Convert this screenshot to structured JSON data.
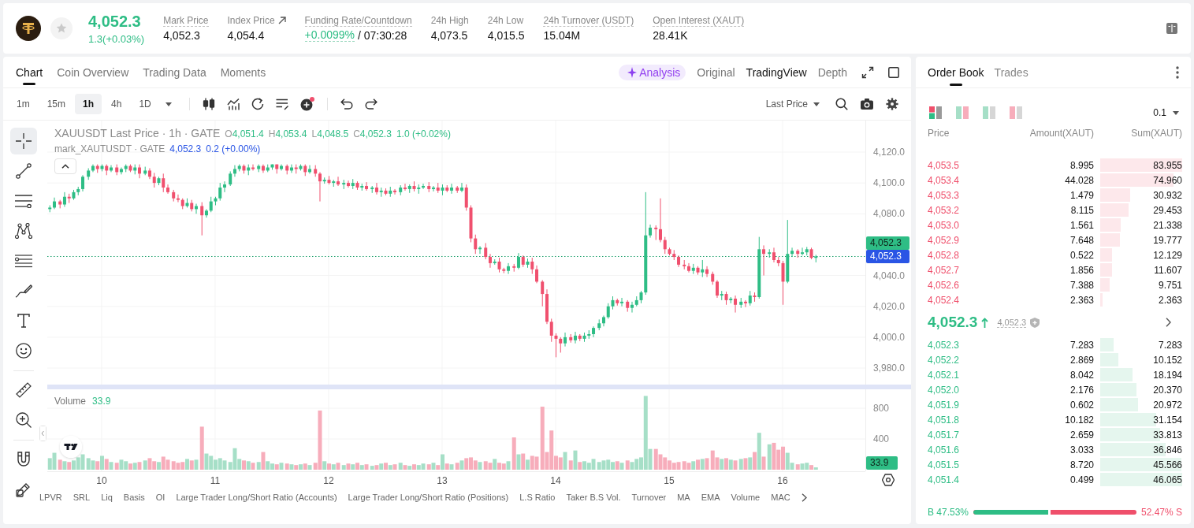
{
  "header": {
    "price": "4,052.3",
    "change": "1.3(+0.03%)",
    "stats": [
      {
        "kind": "plain",
        "label": "Mark Price",
        "value": "4,052.3",
        "underlined": true
      },
      {
        "kind": "link",
        "label": "Index Price",
        "value": "4,054.4",
        "underlined": false
      },
      {
        "kind": "funding",
        "label": "Funding Rate/Countdown",
        "rate": "+0.0099%",
        "value": "/ 07:30:28",
        "underlined": true
      },
      {
        "kind": "plain",
        "label": "24h High",
        "value": "4,073.5",
        "underlined": false
      },
      {
        "kind": "plain",
        "label": "24h Low",
        "value": "4,015.5",
        "underlined": false
      },
      {
        "kind": "plain",
        "label": "24h Turnover (USDT)",
        "value": "15.04M",
        "underlined": true
      },
      {
        "kind": "plain",
        "label": "Open Interest (XAUT)",
        "value": "28.41K",
        "underlined": true
      }
    ]
  },
  "chart_panel": {
    "tabs": [
      {
        "label": "Chart",
        "selected": true
      },
      {
        "label": "Coin Overview",
        "selected": false
      },
      {
        "label": "Trading Data",
        "selected": false
      },
      {
        "label": "Moments",
        "selected": false
      }
    ],
    "views": [
      {
        "kind": "ai",
        "label": "Analysis",
        "selected": false
      },
      {
        "kind": "plain",
        "label": "Original",
        "selected": false
      },
      {
        "kind": "plain",
        "label": "TradingView",
        "selected": true
      },
      {
        "kind": "plain",
        "label": "Depth",
        "selected": false
      }
    ],
    "timeframes": [
      {
        "label": "1m",
        "selected": false
      },
      {
        "label": "15m",
        "selected": false
      },
      {
        "label": "1h",
        "selected": true
      },
      {
        "label": "4h",
        "selected": false
      },
      {
        "label": "1D",
        "selected": false
      }
    ],
    "price_source": "Last Price",
    "drawing_tools": [
      {
        "tools": [
          {
            "kind": "crosshair",
            "selected": true
          },
          {
            "kind": "trend-line",
            "selected": false
          },
          {
            "kind": "horizontal-lines",
            "selected": false
          },
          {
            "kind": "pattern",
            "selected": false
          },
          {
            "kind": "fib",
            "selected": false
          },
          {
            "kind": "brush",
            "selected": false
          },
          {
            "kind": "text",
            "selected": false
          },
          {
            "kind": "emoji",
            "selected": false
          }
        ]
      },
      {
        "tools": [
          {
            "kind": "ruler",
            "selected": false
          },
          {
            "kind": "zoom",
            "selected": false
          }
        ]
      },
      {
        "tools": [
          {
            "kind": "magnet",
            "selected": false
          },
          {
            "kind": "pencil",
            "selected": false
          }
        ]
      }
    ],
    "legend": {
      "title": "XAUUSDT Last Price · 1h · GATE",
      "ohlc": [
        {
          "key": "O",
          "value": "4,051.4"
        },
        {
          "key": "H",
          "value": "4,053.4"
        },
        {
          "key": "L",
          "value": "4,048.5"
        },
        {
          "key": "C",
          "value": "4,052.3"
        }
      ],
      "change": "1.0 (+0.02%)",
      "mark_title": "mark_XAUTUSDT · GATE",
      "mark_value": "4,052.3",
      "mark_change": "0.2 (+0.00%)"
    },
    "chart_data": {
      "type": "candlestick",
      "x": [
        9.54,
        9.58,
        9.63,
        9.67,
        9.71,
        9.75,
        9.79,
        9.83,
        9.88,
        9.92,
        9.96,
        10,
        10.04,
        10.08,
        10.13,
        10.17,
        10.21,
        10.25,
        10.29,
        10.33,
        10.38,
        10.42,
        10.46,
        10.5,
        10.54,
        10.58,
        10.63,
        10.67,
        10.71,
        10.75,
        10.79,
        10.83,
        10.88,
        10.92,
        10.96,
        11,
        11.04,
        11.08,
        11.13,
        11.17,
        11.21,
        11.25,
        11.29,
        11.33,
        11.38,
        11.42,
        11.46,
        11.5,
        11.54,
        11.58,
        11.63,
        11.67,
        11.71,
        11.75,
        11.79,
        11.83,
        11.88,
        11.92,
        11.96,
        12,
        12.04,
        12.08,
        12.13,
        12.17,
        12.21,
        12.25,
        12.29,
        12.33,
        12.38,
        12.42,
        12.46,
        12.5,
        12.54,
        12.58,
        12.63,
        12.67,
        12.71,
        12.75,
        12.79,
        12.83,
        12.88,
        12.92,
        12.96,
        13,
        13.04,
        13.08,
        13.13,
        13.17,
        13.21,
        13.25,
        13.29,
        13.33,
        13.38,
        13.42,
        13.46,
        13.5,
        13.54,
        13.58,
        13.63,
        13.67,
        13.71,
        13.75,
        13.79,
        13.83,
        13.88,
        13.92,
        13.96,
        14,
        14.04,
        14.08,
        14.13,
        14.17,
        14.21,
        14.25,
        14.29,
        14.33,
        14.38,
        14.42,
        14.46,
        14.5,
        14.54,
        14.58,
        14.63,
        14.67,
        14.71,
        14.75,
        14.79,
        14.83,
        14.88,
        14.92,
        14.96,
        15,
        15.04,
        15.08,
        15.13,
        15.17,
        15.21,
        15.25,
        15.29,
        15.33,
        15.38,
        15.42,
        15.46,
        15.5,
        15.54,
        15.58,
        15.63,
        15.67,
        15.71,
        15.75,
        15.79,
        15.83,
        15.88,
        15.92,
        15.96,
        16,
        16.04,
        16.08,
        16.13,
        16.17,
        16.21,
        16.25,
        16.29
      ],
      "ohlc": [
        [
          4083,
          4085.5,
          4081,
          4084
        ],
        [
          4084,
          4090.5,
          4083,
          4088
        ],
        [
          4088,
          4089,
          4083.5,
          4086
        ],
        [
          4086,
          4094,
          4084.5,
          4091
        ],
        [
          4091,
          4093,
          4087,
          4090
        ],
        [
          4090,
          4095.5,
          4089,
          4094
        ],
        [
          4094,
          4097.5,
          4092,
          4096
        ],
        [
          4096,
          4105,
          4094.5,
          4104
        ],
        [
          4104,
          4109.5,
          4102,
          4108
        ],
        [
          4108,
          4112,
          4107,
          4111
        ],
        [
          4111,
          4112,
          4106.5,
          4109
        ],
        [
          4109,
          4112,
          4107.5,
          4111
        ],
        [
          4111,
          4112,
          4105,
          4108
        ],
        [
          4108,
          4111.5,
          4107,
          4110
        ],
        [
          4110,
          4112,
          4105,
          4107
        ],
        [
          4107,
          4110,
          4105.5,
          4109
        ],
        [
          4109,
          4112,
          4107,
          4111
        ],
        [
          4111,
          4112,
          4107,
          4108
        ],
        [
          4108,
          4112,
          4105.5,
          4110
        ],
        [
          4110,
          4112,
          4103,
          4106
        ],
        [
          4106,
          4110.5,
          4105,
          4108
        ],
        [
          4108,
          4109.5,
          4102.5,
          4104
        ],
        [
          4104,
          4106.5,
          4097,
          4100
        ],
        [
          4100,
          4104,
          4098.5,
          4103
        ],
        [
          4103,
          4106,
          4094,
          4097
        ],
        [
          4097,
          4099,
          4093,
          4094
        ],
        [
          4094,
          4095.5,
          4088,
          4090
        ],
        [
          4090,
          4092.5,
          4087.5,
          4089
        ],
        [
          4089,
          4090,
          4083,
          4085
        ],
        [
          4085,
          4090,
          4084,
          4087
        ],
        [
          4087,
          4089,
          4081.5,
          4083
        ],
        [
          4083,
          4086.5,
          4080,
          4085
        ],
        [
          4085,
          4087.5,
          4066,
          4079
        ],
        [
          4079,
          4083,
          4077.5,
          4082
        ],
        [
          4082,
          4091,
          4081,
          4088
        ],
        [
          4088,
          4091,
          4085.5,
          4090
        ],
        [
          4090,
          4100,
          4088.5,
          4097
        ],
        [
          4097,
          4101,
          4094,
          4099
        ],
        [
          4099,
          4107.5,
          4098,
          4106
        ],
        [
          4106,
          4111.5,
          4104,
          4109
        ],
        [
          4109,
          4112,
          4107.5,
          4111
        ],
        [
          4111,
          4112,
          4106,
          4108
        ],
        [
          4108,
          4112,
          4105,
          4110
        ],
        [
          4110,
          4112,
          4108,
          4109
        ],
        [
          4109,
          4112,
          4107,
          4111
        ],
        [
          4111,
          4112,
          4106.5,
          4108
        ],
        [
          4108,
          4112,
          4107,
          4110
        ],
        [
          4110,
          4112,
          4108.5,
          4112
        ],
        [
          4112,
          4112,
          4106,
          4109
        ],
        [
          4109,
          4112,
          4108,
          4111
        ],
        [
          4111,
          4112,
          4105.5,
          4108
        ],
        [
          4108,
          4112,
          4106.5,
          4110
        ],
        [
          4110,
          4112,
          4106,
          4109
        ],
        [
          4109,
          4112,
          4108,
          4111
        ],
        [
          4111,
          4112,
          4104.5,
          4107
        ],
        [
          4107,
          4111.5,
          4106,
          4109
        ],
        [
          4109,
          4111.5,
          4104,
          4106
        ],
        [
          4106,
          4107,
          4088,
          4101
        ],
        [
          4101,
          4103.5,
          4099.5,
          4102
        ],
        [
          4102,
          4104.5,
          4099,
          4100
        ],
        [
          4100,
          4102,
          4097.5,
          4101
        ],
        [
          4101,
          4104,
          4098,
          4099
        ],
        [
          4099,
          4102,
          4096,
          4100
        ],
        [
          4100,
          4101.5,
          4097,
          4098
        ],
        [
          4098,
          4102.5,
          4096,
          4100
        ],
        [
          4100,
          4101,
          4095.5,
          4097
        ],
        [
          4097,
          4099.5,
          4095,
          4098
        ],
        [
          4098,
          4100.5,
          4095,
          4096
        ],
        [
          4096,
          4098,
          4093.5,
          4097
        ],
        [
          4097,
          4100,
          4092.5,
          4094
        ],
        [
          4094,
          4097,
          4091,
          4095
        ],
        [
          4095,
          4096.5,
          4092,
          4093
        ],
        [
          4093,
          4097.5,
          4091,
          4095
        ],
        [
          4095,
          4096,
          4092.5,
          4094
        ],
        [
          4094,
          4098.5,
          4092,
          4097
        ],
        [
          4097,
          4099.5,
          4095,
          4096
        ],
        [
          4096,
          4099,
          4093.5,
          4098
        ],
        [
          4098,
          4101,
          4094.5,
          4096
        ],
        [
          4096,
          4099,
          4093,
          4097
        ],
        [
          4097,
          4099.5,
          4096,
          4098
        ],
        [
          4098,
          4100.5,
          4094,
          4096
        ],
        [
          4096,
          4098,
          4094.5,
          4097
        ],
        [
          4097,
          4100,
          4093.5,
          4095
        ],
        [
          4095,
          4099,
          4092,
          4097
        ],
        [
          4097,
          4098.5,
          4094,
          4095
        ],
        [
          4095,
          4099.5,
          4093,
          4097
        ],
        [
          4097,
          4098,
          4093.5,
          4095
        ],
        [
          4095,
          4100,
          4094,
          4097
        ],
        [
          4097,
          4099,
          4082,
          4084
        ],
        [
          4084,
          4085.5,
          4061.5,
          4064
        ],
        [
          4064,
          4066.5,
          4054,
          4057
        ],
        [
          4057,
          4059,
          4054,
          4058
        ],
        [
          4058,
          4061,
          4050.5,
          4052
        ],
        [
          4052,
          4054,
          4045,
          4048
        ],
        [
          4048,
          4050.5,
          4047,
          4049
        ],
        [
          4049,
          4051.5,
          4042,
          4044
        ],
        [
          4044,
          4045,
          4041.5,
          4043
        ],
        [
          4043,
          4048,
          4041,
          4046
        ],
        [
          4046,
          4047.5,
          4042.5,
          4045
        ],
        [
          4045,
          4054.5,
          4044,
          4052
        ],
        [
          4052,
          4053,
          4045.5,
          4047
        ],
        [
          4047,
          4051,
          4045,
          4049
        ],
        [
          4049,
          4051.5,
          4041,
          4044
        ],
        [
          4044,
          4046.5,
          4035,
          4036
        ],
        [
          4036,
          4037,
          4020,
          4028
        ],
        [
          4028,
          4031,
          4008.5,
          4010
        ],
        [
          4010,
          4012,
          3997,
          4001
        ],
        [
          4001,
          4002.5,
          3987,
          3999
        ],
        [
          3999,
          4000,
          3990,
          3996
        ],
        [
          3996,
          4003,
          3994,
          4000
        ],
        [
          4000,
          4002,
          3996.5,
          3998
        ],
        [
          3998,
          4003.5,
          3996,
          4001
        ],
        [
          4001,
          4002,
          3997.5,
          3999
        ],
        [
          3999,
          4003,
          3997,
          4001
        ],
        [
          4001,
          4004.5,
          3999,
          4002
        ],
        [
          4002,
          4007,
          4000,
          4006
        ],
        [
          4006,
          4011.5,
          4004.5,
          4009
        ],
        [
          4009,
          4014,
          4007,
          4013
        ],
        [
          4013,
          4022,
          4012,
          4020
        ],
        [
          4020,
          4026.5,
          4018,
          4024
        ],
        [
          4024,
          4025,
          4020.5,
          4022
        ],
        [
          4022,
          4025.5,
          4020,
          4023
        ],
        [
          4023,
          4024,
          4016.5,
          4019
        ],
        [
          4019,
          4023,
          4016,
          4021
        ],
        [
          4021,
          4026.5,
          4020,
          4024
        ],
        [
          4024,
          4030,
          4022,
          4029
        ],
        [
          4029,
          4094,
          4027.5,
          4066
        ],
        [
          4066,
          4073,
          4064.5,
          4071
        ],
        [
          4071,
          4072.5,
          4063,
          4070
        ],
        [
          4070,
          4090,
          4061.5,
          4063
        ],
        [
          4063,
          4065,
          4054,
          4057
        ],
        [
          4057,
          4058,
          4053,
          4054
        ],
        [
          4054,
          4056.5,
          4050,
          4052
        ],
        [
          4052,
          4053,
          4045.5,
          4047
        ],
        [
          4047,
          4050,
          4044,
          4046
        ],
        [
          4046,
          4048,
          4042,
          4043
        ],
        [
          4043,
          4047.5,
          4041,
          4045
        ],
        [
          4045,
          4046,
          4040.5,
          4042
        ],
        [
          4042,
          4050,
          4039,
          4044
        ],
        [
          4044,
          4046,
          4039,
          4041
        ],
        [
          4041,
          4042.5,
          4034,
          4036
        ],
        [
          4036,
          4037,
          4025.5,
          4027
        ],
        [
          4027,
          4030,
          4024,
          4028
        ],
        [
          4028,
          4029.5,
          4021,
          4024
        ],
        [
          4024,
          4026,
          4022,
          4025
        ],
        [
          4025,
          4027,
          4016,
          4021
        ],
        [
          4021,
          4025.5,
          4019,
          4023
        ],
        [
          4023,
          4024,
          4019.5,
          4022
        ],
        [
          4022,
          4030,
          4020.5,
          4027
        ],
        [
          4027,
          4029,
          4023,
          4026
        ],
        [
          4026,
          4065,
          4025,
          4057
        ],
        [
          4057,
          4059.5,
          4040,
          4054
        ],
        [
          4054,
          4057,
          4051.5,
          4055
        ],
        [
          4055,
          4058,
          4048.5,
          4050
        ],
        [
          4050,
          4052,
          4046,
          4048
        ],
        [
          4048,
          4049.5,
          4021,
          4036
        ],
        [
          4036,
          4076,
          4035,
          4054
        ],
        [
          4054,
          4058,
          4052,
          4056
        ],
        [
          4056,
          4057,
          4051.5,
          4054
        ],
        [
          4054,
          4058,
          4053,
          4055
        ],
        [
          4055,
          4058.5,
          4053,
          4057
        ],
        [
          4057,
          4058,
          4050.5,
          4051.4
        ],
        [
          4051.4,
          4053.4,
          4048.5,
          4052.3
        ]
      ],
      "xlim": [
        9.521,
        16.729
      ],
      "ylim": [
        3969.3,
        4140.4
      ],
      "yticks": [
        {
          "value": 4120,
          "label": "4,120.0"
        },
        {
          "value": 4100,
          "label": "4,100.0"
        },
        {
          "value": 4080,
          "label": "4,080.0"
        },
        {
          "value": 4040,
          "label": "4,040.0"
        },
        {
          "value": 4020,
          "label": "4,020.0"
        },
        {
          "value": 4000,
          "label": "4,000.0"
        },
        {
          "value": 3980,
          "label": "3,980.0"
        }
      ],
      "grid": true,
      "ref_lines": [
        {
          "axis": "y",
          "value": 4052.3,
          "color": "#1a9e6a"
        }
      ]
    },
    "last_price_tag": "4,052.3",
    "mark_price_tag": "4,052.3",
    "volume": {
      "title": "Volume",
      "value": "33.9",
      "tag": "33.9",
      "chart_data": {
        "type": "bar",
        "x": [
          9.54,
          9.58,
          9.63,
          9.67,
          9.71,
          9.75,
          9.79,
          9.83,
          9.88,
          9.92,
          9.96,
          10,
          10.04,
          10.08,
          10.13,
          10.17,
          10.21,
          10.25,
          10.29,
          10.33,
          10.38,
          10.42,
          10.46,
          10.5,
          10.54,
          10.58,
          10.63,
          10.67,
          10.71,
          10.75,
          10.79,
          10.83,
          10.88,
          10.92,
          10.96,
          11,
          11.04,
          11.08,
          11.13,
          11.17,
          11.21,
          11.25,
          11.29,
          11.33,
          11.38,
          11.42,
          11.46,
          11.5,
          11.54,
          11.58,
          11.63,
          11.67,
          11.71,
          11.75,
          11.79,
          11.83,
          11.88,
          11.92,
          11.96,
          12,
          12.04,
          12.08,
          12.13,
          12.17,
          12.21,
          12.25,
          12.29,
          12.33,
          12.38,
          12.42,
          12.46,
          12.5,
          12.54,
          12.58,
          12.63,
          12.67,
          12.71,
          12.75,
          12.79,
          12.83,
          12.88,
          12.92,
          12.96,
          13,
          13.04,
          13.08,
          13.13,
          13.17,
          13.21,
          13.25,
          13.29,
          13.33,
          13.38,
          13.42,
          13.46,
          13.5,
          13.54,
          13.58,
          13.63,
          13.67,
          13.71,
          13.75,
          13.79,
          13.83,
          13.88,
          13.92,
          13.96,
          14,
          14.04,
          14.08,
          14.13,
          14.17,
          14.21,
          14.25,
          14.29,
          14.33,
          14.38,
          14.42,
          14.46,
          14.5,
          14.54,
          14.58,
          14.63,
          14.67,
          14.71,
          14.75,
          14.79,
          14.83,
          14.88,
          14.92,
          14.96,
          15,
          15.04,
          15.08,
          15.13,
          15.17,
          15.21,
          15.25,
          15.29,
          15.33,
          15.38,
          15.42,
          15.46,
          15.5,
          15.54,
          15.58,
          15.63,
          15.67,
          15.71,
          15.75,
          15.79,
          15.83,
          15.88,
          15.92,
          15.96,
          16,
          16.04,
          16.08,
          16.13,
          16.17,
          16.21,
          16.25,
          16.29
        ],
        "values": [
          150,
          220,
          130,
          110,
          100,
          120,
          160,
          200,
          150,
          120,
          110,
          180,
          140,
          100,
          90,
          130,
          110,
          80,
          90,
          100,
          120,
          150,
          110,
          100,
          170,
          130,
          110,
          90,
          100,
          140,
          120,
          130,
          560,
          210,
          180,
          130,
          150,
          120,
          100,
          280,
          140,
          120,
          110,
          90,
          100,
          230,
          110,
          80,
          70,
          90,
          80,
          70,
          60,
          70,
          80,
          60,
          90,
          770,
          110,
          80,
          70,
          90,
          60,
          80,
          70,
          90,
          60,
          70,
          50,
          60,
          80,
          90,
          60,
          70,
          90,
          60,
          50,
          70,
          60,
          80,
          70,
          90,
          60,
          200,
          80,
          70,
          90,
          120,
          150,
          160,
          120,
          100,
          110,
          90,
          140,
          90,
          80,
          110,
          420,
          200,
          210,
          130,
          180,
          170,
          820,
          230,
          510,
          180,
          160,
          230,
          120,
          250,
          100,
          110,
          90,
          140,
          100,
          120,
          130,
          100,
          110,
          90,
          120,
          100,
          140,
          160,
          960,
          270,
          270,
          200,
          160,
          120,
          90,
          100,
          110,
          90,
          110,
          130,
          140,
          150,
          250,
          160,
          140,
          150,
          130,
          120,
          140,
          150,
          160,
          230,
          480,
          170,
          330,
          350,
          260,
          300,
          220,
          90,
          70,
          80,
          90,
          60,
          30
        ],
        "xlim": [
          9.521,
          16.729
        ],
        "ylim": [
          -20.5,
          1046.2
        ],
        "xticks": [
          {
            "value": 10,
            "label": "10"
          },
          {
            "value": 11,
            "label": "11"
          },
          {
            "value": 12,
            "label": "12"
          },
          {
            "value": 13,
            "label": "13"
          },
          {
            "value": 14,
            "label": "14"
          },
          {
            "value": 15,
            "label": "15"
          },
          {
            "value": 16,
            "label": "16"
          }
        ],
        "yticks": [
          {
            "value": 800,
            "label": "800"
          },
          {
            "value": 400,
            "label": "400"
          }
        ],
        "grid": true
      }
    },
    "indicators": [
      "LPVR",
      "SRL",
      "Liq",
      "Basis",
      "OI",
      "Large Trader Long/Short Ratio (Accounts)",
      "Large Trader Long/Short Ratio (Positions)",
      "L.S Ratio",
      "Taker B.S Vol.",
      "Turnover",
      "MA",
      "EMA",
      "Volume",
      "MAC"
    ]
  },
  "order_book": {
    "tabs": [
      {
        "label": "Order Book",
        "selected": true
      },
      {
        "label": "Trades",
        "selected": false
      }
    ],
    "precision": "0.1",
    "columns": [
      "Price",
      "Amount(XAUT)",
      "Sum(XAUT)"
    ],
    "asks": [
      {
        "price": "4,053.5",
        "amount": "8.995",
        "sum": "83.955",
        "level": 1.0
      },
      {
        "price": "4,053.4",
        "amount": "44.028",
        "sum": "74.960",
        "level": 0.89
      },
      {
        "price": "4,053.3",
        "amount": "1.479",
        "sum": "30.932",
        "level": 0.37
      },
      {
        "price": "4,053.2",
        "amount": "8.115",
        "sum": "29.453",
        "level": 0.35
      },
      {
        "price": "4,053.0",
        "amount": "1.561",
        "sum": "21.338",
        "level": 0.25
      },
      {
        "price": "4,052.9",
        "amount": "7.648",
        "sum": "19.777",
        "level": 0.24
      },
      {
        "price": "4,052.8",
        "amount": "0.522",
        "sum": "12.129",
        "level": 0.14
      },
      {
        "price": "4,052.7",
        "amount": "1.856",
        "sum": "11.607",
        "level": 0.14
      },
      {
        "price": "4,052.6",
        "amount": "7.388",
        "sum": "9.751",
        "level": 0.12
      },
      {
        "price": "4,052.4",
        "amount": "2.363",
        "sum": "2.363",
        "level": 0.03
      }
    ],
    "last_price": "4,052.3",
    "mark_price": "4,052.3",
    "bids": [
      {
        "price": "4,052.3",
        "amount": "7.283",
        "sum": "7.283",
        "level": 0.16
      },
      {
        "price": "4,052.2",
        "amount": "2.869",
        "sum": "10.152",
        "level": 0.22
      },
      {
        "price": "4,052.1",
        "amount": "8.042",
        "sum": "18.194",
        "level": 0.39
      },
      {
        "price": "4,052.0",
        "amount": "2.176",
        "sum": "20.370",
        "level": 0.44
      },
      {
        "price": "4,051.9",
        "amount": "0.602",
        "sum": "20.972",
        "level": 0.46
      },
      {
        "price": "4,051.8",
        "amount": "10.182",
        "sum": "31.154",
        "level": 0.68
      },
      {
        "price": "4,051.7",
        "amount": "2.659",
        "sum": "33.813",
        "level": 0.73
      },
      {
        "price": "4,051.6",
        "amount": "3.033",
        "sum": "36.846",
        "level": 0.8
      },
      {
        "price": "4,051.5",
        "amount": "8.720",
        "sum": "45.566",
        "level": 0.99
      },
      {
        "price": "4,051.4",
        "amount": "0.499",
        "sum": "46.065",
        "level": 1.0
      }
    ],
    "ratio": {
      "buy": "B 47.53%",
      "sell": "52.47% S",
      "level": 0.4753
    }
  }
}
